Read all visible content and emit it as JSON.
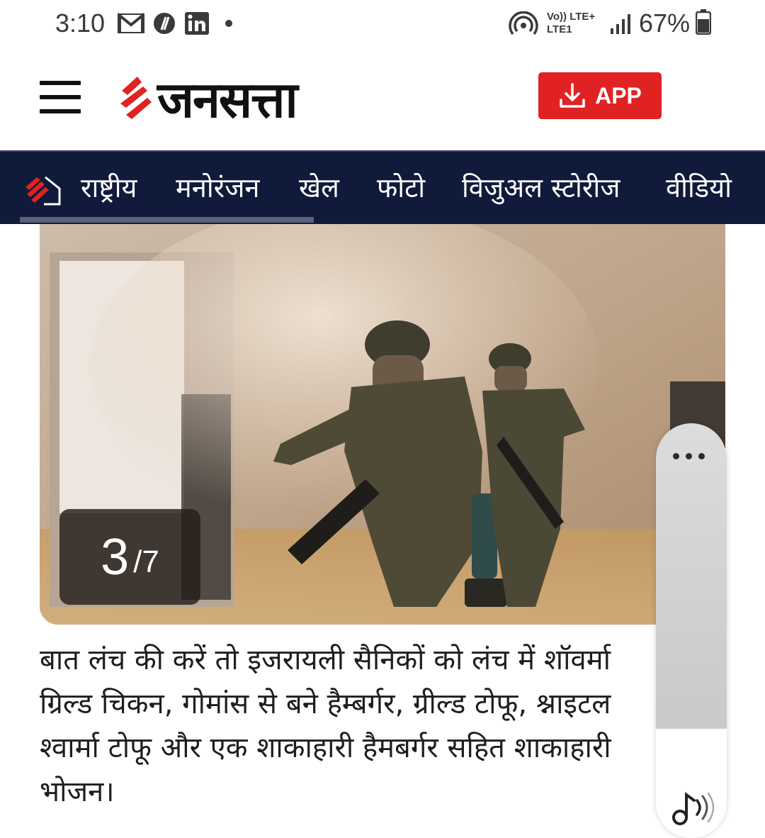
{
  "status_bar": {
    "time": "3:10",
    "battery": "67%",
    "network_top": "Vo)) LTE+",
    "network_bottom": "LTE1",
    "icons": [
      "gmail-icon",
      "app-icon",
      "linkedin-icon",
      "dot-icon",
      "hotspot-icon",
      "signal-icon",
      "battery-icon"
    ]
  },
  "header": {
    "logo_text": "जनसत्ता",
    "app_button_label": "APP",
    "colors": {
      "brand_red": "#e02222",
      "nav_bg": "#101a3a"
    }
  },
  "nav": {
    "items": [
      "राष्ट्रीय",
      "मनोरंजन",
      "खेल",
      "फोटो",
      "विजुअल स्टोरीज",
      "वीडियो"
    ]
  },
  "gallery": {
    "current": "3",
    "total": "/7"
  },
  "article": {
    "lines": [
      "बात लंच की करें तो इजरायली सैनिकों को लंच में शॉवर्मा",
      "ग्रिल्ड चिकन, गोमांस से बने हैम्बर्गर, ग्रील्ड टोफू, श्नाइटल",
      "श्वार्मा टोफू और एक शाकाहारी हैमबर्गर सहित शाकाहारी",
      "भोजन।"
    ]
  }
}
